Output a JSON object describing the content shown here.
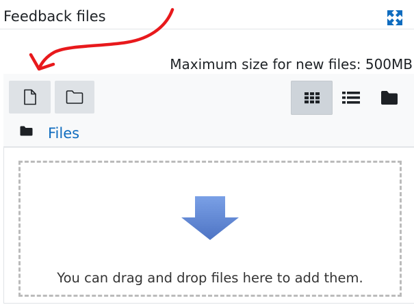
{
  "section": {
    "title": "Feedback files",
    "expand_icon": "expand-arrows-icon"
  },
  "filemanager": {
    "max_size_text": "Maximum size for new files: 500MB",
    "toolbar": {
      "add_file_icon": "file-icon",
      "create_folder_icon": "folder-outline-icon",
      "view_icons_icon": "grid-icon",
      "view_list_icon": "list-icon",
      "view_tree_icon": "folder-solid-icon",
      "active_view": "icons"
    },
    "breadcrumb": {
      "icon": "folder-solid-icon",
      "label": "Files"
    },
    "dropzone": {
      "icon": "down-arrow-icon",
      "text": "You can drag and drop files here to add them."
    }
  },
  "colors": {
    "link": "#0f6cbf",
    "arrow_fill": "#5f8bd9",
    "annotation": "#e8191c"
  }
}
